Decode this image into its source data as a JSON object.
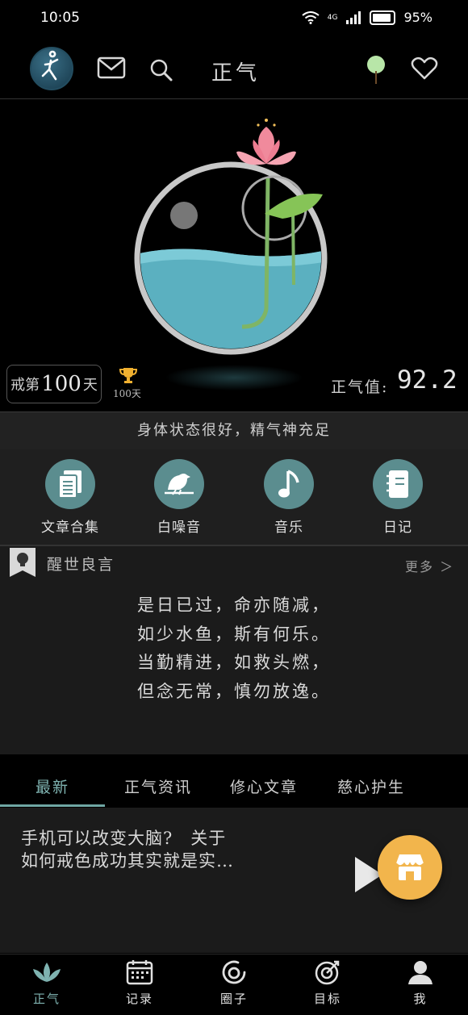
{
  "status_bar": {
    "time": "10:05",
    "network": "4G",
    "battery": "95%"
  },
  "header": {
    "title": "正气",
    "icons": [
      "jordan-avatar-icon",
      "mail-icon",
      "search-icon",
      "tree-icon",
      "heart-icon"
    ]
  },
  "hero": {
    "quit_prefix": "戒第",
    "quit_days": "100",
    "quit_suffix": "天",
    "trophy_label": "100天",
    "zhengqi_label": "正气值:",
    "zhengqi_value": "92.2"
  },
  "state": "身体状态很好，精气神充足",
  "quick_menu": [
    {
      "label": "文章合集",
      "icon": "document-icon"
    },
    {
      "label": "白噪音",
      "icon": "bird-icon"
    },
    {
      "label": "音乐",
      "icon": "music-note-icon"
    },
    {
      "label": "日记",
      "icon": "notebook-icon"
    }
  ],
  "quote": {
    "title": "醒世良言",
    "more": "更多 ＞",
    "lines": [
      "是日已过，命亦随减，",
      "如少水鱼，斯有何乐。",
      "当勤精进，如救头燃，",
      "但念无常，慎勿放逸。"
    ]
  },
  "tabs": [
    "最新",
    "正气资讯",
    "修心文章",
    "慈心护生"
  ],
  "article": {
    "line1": "手机可以改变大脑?　关于",
    "line2": "如何戒色成功其实就是实…"
  },
  "bottom_nav": [
    "正气",
    "记录",
    "圈子",
    "目标",
    "我"
  ],
  "colors": {
    "accent": "#7fb3b1",
    "quick_icon_bg": "#5b8d8f",
    "fab": "#f2b54c"
  }
}
